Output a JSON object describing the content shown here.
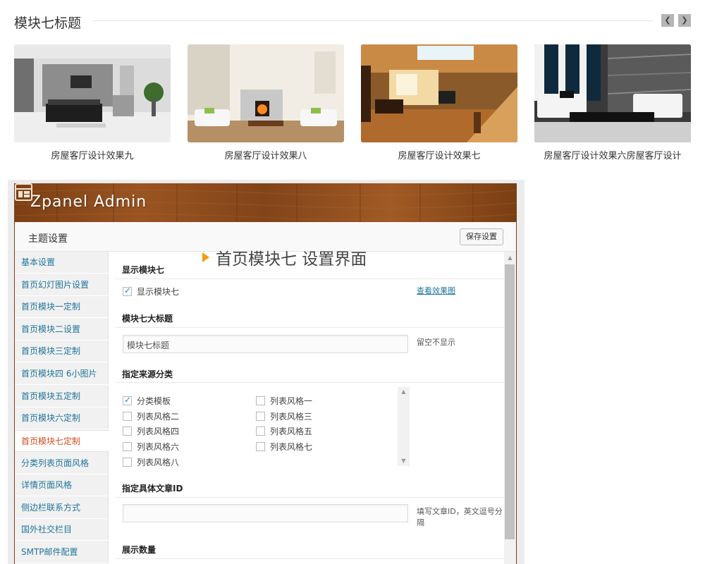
{
  "module": {
    "title": "模块七标题",
    "prev_icon": "chevron-left-icon",
    "next_icon": "chevron-right-icon",
    "items": [
      {
        "caption": "房屋客厅设计效果九"
      },
      {
        "caption": "房屋客厅设计效果八"
      },
      {
        "caption": "房屋客厅设计效果七"
      },
      {
        "caption": "房屋客厅设计效果六房屋客厅设计"
      }
    ]
  },
  "admin": {
    "brand": "Zpanel  Admin",
    "settings_title": "主题设置",
    "save_label": "保存设置",
    "overlay_label": "首页模块七 设置界面",
    "sidebar": [
      {
        "label": "基本设置"
      },
      {
        "label": "首页幻灯图片设置"
      },
      {
        "label": "首页模块一定制"
      },
      {
        "label": "首页模块二设置"
      },
      {
        "label": "首页模块三定制"
      },
      {
        "label": "首页模块四 6小图片"
      },
      {
        "label": "首页模块五定制"
      },
      {
        "label": "首页模块六定制"
      },
      {
        "label": "首页模块七定制",
        "active": true
      },
      {
        "label": "分类列表页面风格"
      },
      {
        "label": "详情页面风格"
      },
      {
        "label": "侧边栏联系方式"
      },
      {
        "label": "国外社交栏目"
      },
      {
        "label": "SMTP邮件配置"
      }
    ],
    "sections": {
      "show_title": "显示模块七",
      "show_checkbox": "显示模块七",
      "preview_link": "查看效果图",
      "big_title": "模块七大标题",
      "big_title_value": "模块七标题",
      "big_title_hint": "留空不显示",
      "source_title": "指定来源分类",
      "categories": [
        {
          "label": "分类模板",
          "checked": true
        },
        {
          "label": "列表风格一",
          "checked": false
        },
        {
          "label": "列表风格二",
          "checked": false
        },
        {
          "label": "列表风格三",
          "checked": false
        },
        {
          "label": "列表风格四",
          "checked": false
        },
        {
          "label": "列表风格五",
          "checked": false
        },
        {
          "label": "列表风格六",
          "checked": false
        },
        {
          "label": "列表风格七",
          "checked": false
        },
        {
          "label": "列表风格八",
          "checked": false
        }
      ],
      "article_id_title": "指定具体文章ID",
      "article_id_value": "",
      "article_id_hint": "填写文章ID，英文逗号分隔",
      "count_title": "展示数量"
    }
  }
}
